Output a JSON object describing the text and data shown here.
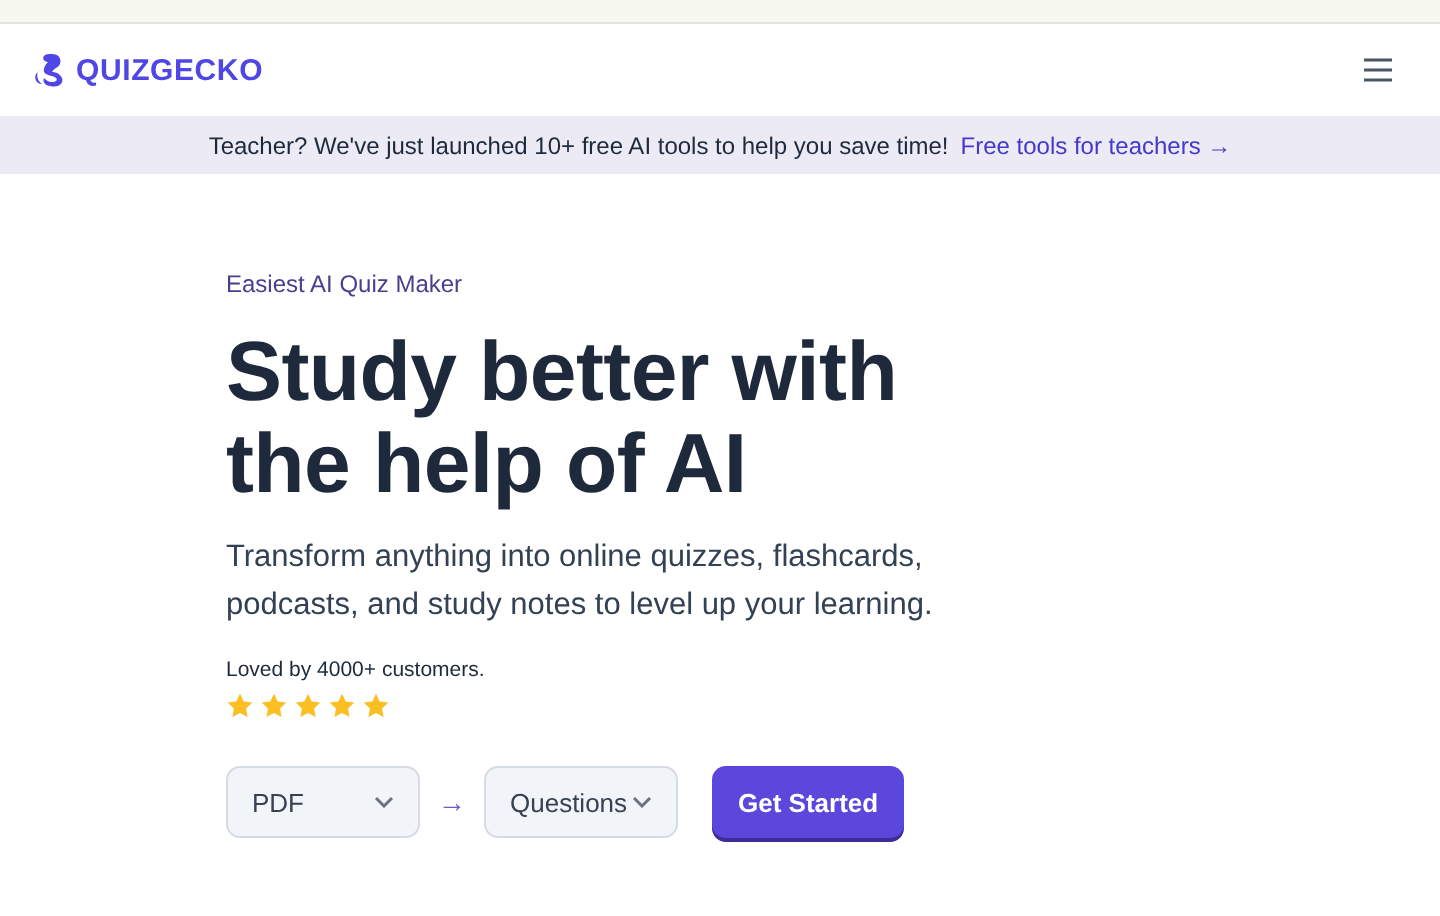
{
  "header": {
    "logo": "QUIZGECKO"
  },
  "banner": {
    "text": "Teacher? We've just launched 10+ free AI tools to help you save time!",
    "link": "Free tools for teachers →"
  },
  "hero": {
    "eyebrow": "Easiest AI Quiz Maker",
    "title": "Study better with the help of AI",
    "subtitle": "Transform anything into online quizzes, flashcards, podcasts, and study notes to level up your learning.",
    "social_proof": "Loved by 4000+ customers.",
    "stars": 5,
    "source_select": {
      "value": "PDF"
    },
    "arrow": "→",
    "output_select": {
      "value": "Questions"
    },
    "cta": "Get Started"
  }
}
